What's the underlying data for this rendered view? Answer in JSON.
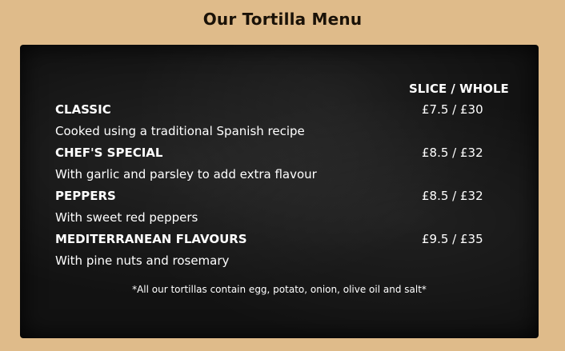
{
  "header": {
    "title": "Our Tortilla Menu"
  },
  "menu": {
    "column_header": "SLICE / WHOLE",
    "items": [
      {
        "name": "CLASSIC",
        "description": "Cooked using a traditional Spanish recipe",
        "price": "£7.5 / £30"
      },
      {
        "name": "CHEF'S SPECIAL",
        "description": "With garlic and parsley to add extra flavour",
        "price": "£8.5 / £32"
      },
      {
        "name": "PEPPERS",
        "description": "With sweet red peppers",
        "price": "£8.5 / £32"
      },
      {
        "name": "MEDITERRANEAN FLAVOURS",
        "description": "With pine nuts and rosemary",
        "price": "£9.5 / £35"
      }
    ],
    "footnote": "*All our tortillas contain egg, potato, onion, olive oil and salt*"
  },
  "colors": {
    "page_background": "#dfbb8a",
    "board_background": "#121212",
    "title_text": "#1a1208",
    "board_text": "#ffffff"
  }
}
